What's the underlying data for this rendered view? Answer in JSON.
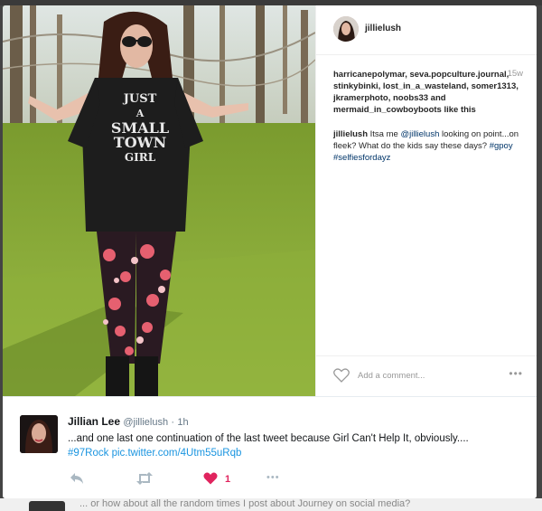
{
  "instagram": {
    "username": "jillielush",
    "time_ago": "15w",
    "likes_line": "harricanepolymar, seva.popculture.journal, stinkybinki, lost_in_a_wasteland, somer1313, jkramerphoto, noobs33 and mermaid_in_cowboyboots like this",
    "caption_user": "jillielush",
    "caption_pre": " Itsa me ",
    "caption_mention": "@jillielush",
    "caption_mid": " looking on point...on fleek? What do the kids say these days? ",
    "caption_tags": "#gpoy #selfiesfordayz",
    "add_comment_placeholder": "Add a comment...",
    "more_label": "•••",
    "shirt_lines": [
      "JUST",
      "A",
      "SMALL",
      "TOWN",
      "GIRL"
    ]
  },
  "tweet": {
    "name": "Jillian Lee",
    "handle": "@jillielush",
    "separator": "·",
    "time": "1h",
    "text": "...and one last one continuation of the last tweet because Girl Can't Help It, obviously....",
    "hashtag": "#97Rock",
    "pic_link": "pic.twitter.com/4Utm55uRqb",
    "like_count": "1",
    "more_label": "•••"
  },
  "background_text": "... or how about all the random times I post about Journey on social media?",
  "colors": {
    "twitter_link": "#1b95e0",
    "like_red": "#e0245e",
    "ig_link": "#003569"
  }
}
